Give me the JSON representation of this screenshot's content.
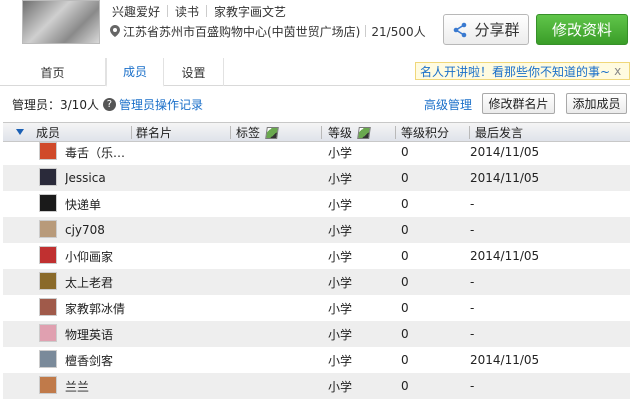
{
  "header": {
    "tags": [
      "兴趣爱好",
      "读书",
      "家教字画文艺"
    ],
    "location": "江苏省苏州市百盛购物中心(中茵世贸广场店)",
    "member_count": "21/500人",
    "share_label": "分享群",
    "edit_label": "修改资料"
  },
  "tabs": [
    {
      "label": "首页"
    },
    {
      "label": "成员"
    },
    {
      "label": "设置"
    }
  ],
  "banner": {
    "text": "名人开讲啦！看那些你不知道的事~",
    "close": "x"
  },
  "toolbar": {
    "admin_count": "管理员：3/10人",
    "admin_log": "管理员操作记录",
    "advanced": "高级管理",
    "edit_card": "修改群名片",
    "add_member": "添加成员"
  },
  "columns": [
    "成员",
    "群名片",
    "标签",
    "等级",
    "等级积分",
    "最后发言"
  ],
  "members": [
    {
      "name": "毒舌（乐…",
      "card": "",
      "tag": "",
      "level": "小学",
      "points": "0",
      "last": "2014/11/05",
      "color": "#d04a2a"
    },
    {
      "name": "Jessica",
      "card": "",
      "tag": "",
      "level": "小学",
      "points": "0",
      "last": "2014/11/05",
      "color": "#2a2a3a"
    },
    {
      "name": "快递单",
      "card": "",
      "tag": "",
      "level": "小学",
      "points": "0",
      "last": "-",
      "color": "#1a1a1a"
    },
    {
      "name": "cjy708",
      "card": "",
      "tag": "",
      "level": "小学",
      "points": "0",
      "last": "-",
      "color": "#b89a7a"
    },
    {
      "name": "小仰画家",
      "card": "",
      "tag": "",
      "level": "小学",
      "points": "0",
      "last": "2014/11/05",
      "color": "#c03030"
    },
    {
      "name": "太上老君",
      "card": "",
      "tag": "",
      "level": "小学",
      "points": "0",
      "last": "-",
      "color": "#8a6a2a"
    },
    {
      "name": "家教郭冰倩",
      "card": "",
      "tag": "",
      "level": "小学",
      "points": "0",
      "last": "-",
      "color": "#a05a4a"
    },
    {
      "name": "物理英语",
      "card": "",
      "tag": "",
      "level": "小学",
      "points": "0",
      "last": "-",
      "color": "#e0a0b0"
    },
    {
      "name": "檀香剑客",
      "card": "",
      "tag": "",
      "level": "小学",
      "points": "0",
      "last": "2014/11/05",
      "color": "#7a8a9a"
    },
    {
      "name": "兰兰",
      "card": "",
      "tag": "",
      "level": "小学",
      "points": "0",
      "last": "-",
      "color": "#c07a4a"
    }
  ]
}
